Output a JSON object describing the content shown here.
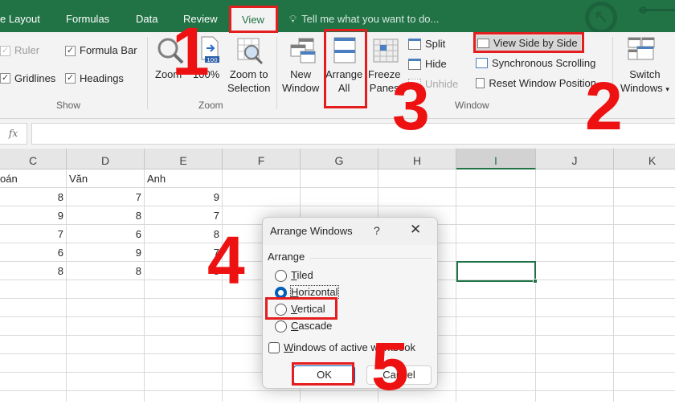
{
  "tabs": {
    "items": [
      {
        "label": "e Layout"
      },
      {
        "label": "Formulas"
      },
      {
        "label": "Data"
      },
      {
        "label": "Review"
      },
      {
        "label": "View",
        "active": true
      }
    ],
    "tell_me": "Tell me what you want to do..."
  },
  "ribbon": {
    "show": {
      "name": "Show",
      "ruler": {
        "label": "Ruler",
        "checked": true,
        "disabled": true
      },
      "formula_bar": {
        "label": "Formula Bar",
        "checked": true
      },
      "gridlines": {
        "label": "Gridlines",
        "checked": true
      },
      "headings": {
        "label": "Headings",
        "checked": true
      }
    },
    "zoom": {
      "name": "Zoom",
      "zoom_label": "Zoom",
      "hundred_label": "100%",
      "hundred_badge": "100",
      "zoom_selection_line1": "Zoom to",
      "zoom_selection_line2": "Selection"
    },
    "window": {
      "name": "Window",
      "new_window_line1": "New",
      "new_window_line2": "Window",
      "arrange_all_line1": "Arrange",
      "arrange_all_line2": "All",
      "freeze_line1": "Freeze",
      "freeze_line2": "Panes",
      "split": "Split",
      "hide": "Hide",
      "unhide": "Unhide",
      "view_side_by_side": "View Side by Side",
      "sync_scrolling": "Synchronous Scrolling",
      "reset_position": "Reset Window Position",
      "switch_line1": "Switch",
      "switch_line2": "Windows"
    }
  },
  "formula_bar": {
    "fx": "fx",
    "value": ""
  },
  "columns": [
    "C",
    "D",
    "E",
    "F",
    "G",
    "H",
    "I",
    "J",
    "K"
  ],
  "selected_column": "I",
  "sheet": {
    "headers": [
      "oán",
      "Văn",
      "Anh"
    ],
    "rows": [
      [
        "8",
        "7",
        "9"
      ],
      [
        "9",
        "8",
        "7"
      ],
      [
        "7",
        "6",
        "8"
      ],
      [
        "6",
        "9",
        "7"
      ],
      [
        "8",
        "8",
        "8"
      ]
    ]
  },
  "dialog": {
    "title": "Arrange Windows",
    "help": "?",
    "close": "✕",
    "group": "Arrange",
    "options": [
      {
        "key": "T",
        "rest": "iled",
        "selected": false
      },
      {
        "key": "H",
        "rest": "orizontal",
        "selected": true
      },
      {
        "key": "V",
        "rest": "ertical",
        "selected": false
      },
      {
        "key": "C",
        "rest": "ascade",
        "selected": false
      }
    ],
    "active_workbook_key": "W",
    "active_workbook_rest": "indows of active workbook",
    "active_workbook_checked": false,
    "ok": "OK",
    "cancel": "Cancel"
  },
  "annotations": {
    "steps": [
      "1",
      "2",
      "3",
      "4",
      "5"
    ],
    "color": "#e41e1e"
  },
  "colors": {
    "excel_green": "#217346",
    "ribbon_bg": "#f3f3f3",
    "accent_blue": "#005fb8"
  }
}
